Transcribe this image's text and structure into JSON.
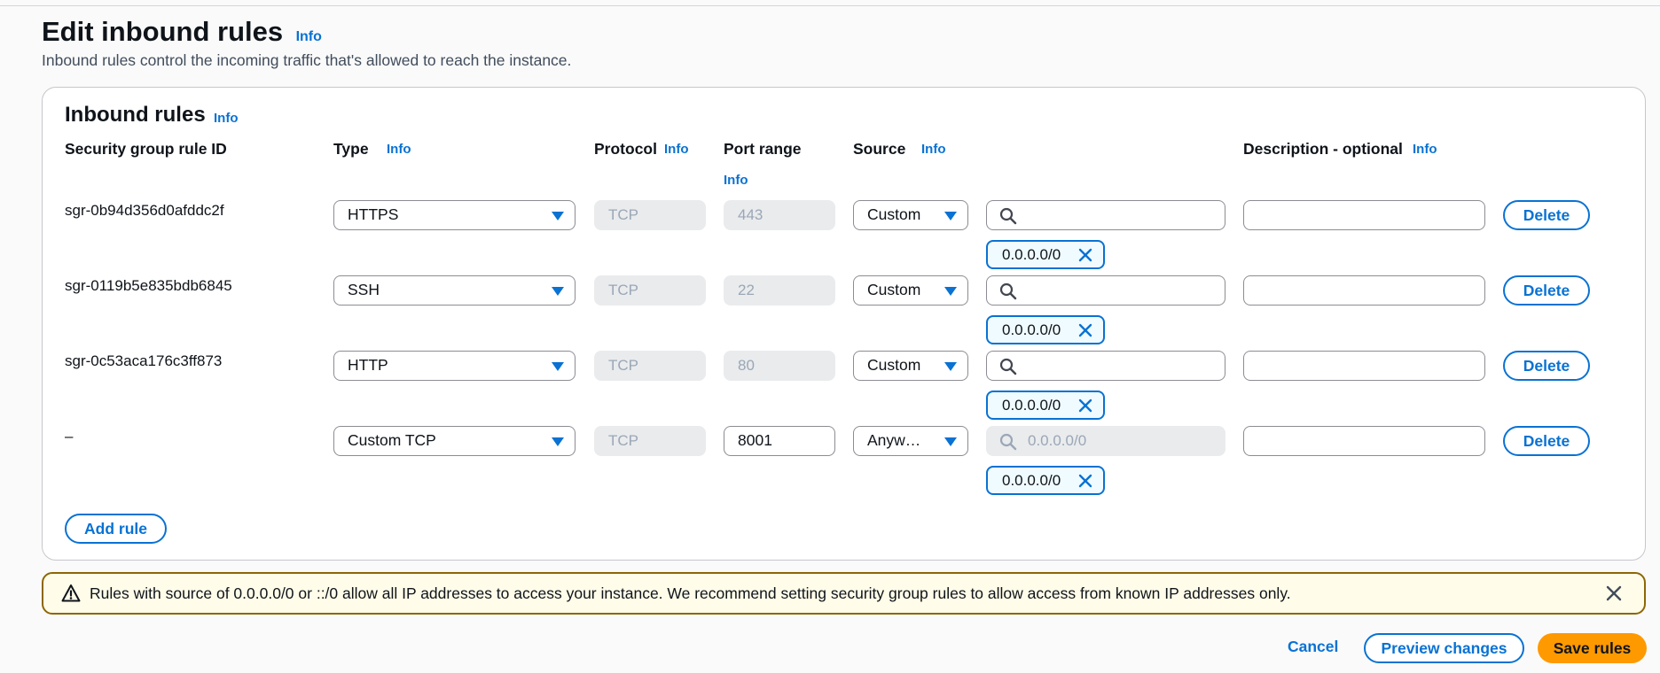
{
  "page": {
    "title": "Edit inbound rules",
    "title_info": "Info",
    "description": "Inbound rules control the incoming traffic that's allowed to reach the instance."
  },
  "panel": {
    "title": "Inbound rules",
    "title_info": "Info",
    "columns": {
      "rule_id": "Security group rule ID",
      "type": "Type",
      "type_info": "Info",
      "protocol": "Protocol",
      "protocol_info": "Info",
      "port_range": "Port range",
      "port_range_info": "Info",
      "source": "Source",
      "source_info": "Info",
      "description": "Description - optional",
      "description_info": "Info"
    },
    "rows": [
      {
        "rule_id": "sgr-0b94d356d0afddc2f",
        "type": "HTTPS",
        "protocol": "TCP",
        "port_range": "443",
        "source_type": "Custom",
        "search_placeholder": "",
        "cidr": "0.0.0.0/0",
        "description": "",
        "delete_label": "Delete"
      },
      {
        "rule_id": "sgr-0119b5e835bdb6845",
        "type": "SSH",
        "protocol": "TCP",
        "port_range": "22",
        "source_type": "Custom",
        "search_placeholder": "",
        "cidr": "0.0.0.0/0",
        "description": "",
        "delete_label": "Delete"
      },
      {
        "rule_id": "sgr-0c53aca176c3ff873",
        "type": "HTTP",
        "protocol": "TCP",
        "port_range": "80",
        "source_type": "Custom",
        "search_placeholder": "",
        "cidr": "0.0.0.0/0",
        "description": "",
        "delete_label": "Delete"
      },
      {
        "rule_id": "–",
        "type": "Custom TCP",
        "protocol": "TCP",
        "port_range": "8001",
        "source_type": "Anyw…",
        "search_placeholder": "0.0.0.0/0",
        "cidr": "0.0.0.0/0",
        "description": "",
        "delete_label": "Delete"
      }
    ],
    "add_rule_label": "Add rule"
  },
  "alert": {
    "text": "Rules with source of 0.0.0.0/0 or ::/0 allow all IP addresses to access your instance. We recommend setting security group rules to allow access from known IP addresses only.",
    "icon": "warning-icon"
  },
  "footer": {
    "cancel_label": "Cancel",
    "preview_label": "Preview changes",
    "save_label": "Save rules"
  },
  "colors": {
    "accent": "#0972d3",
    "primary_button": "#ff9900",
    "warning_border": "#8d6605",
    "warning_bg": "#fffce9"
  }
}
